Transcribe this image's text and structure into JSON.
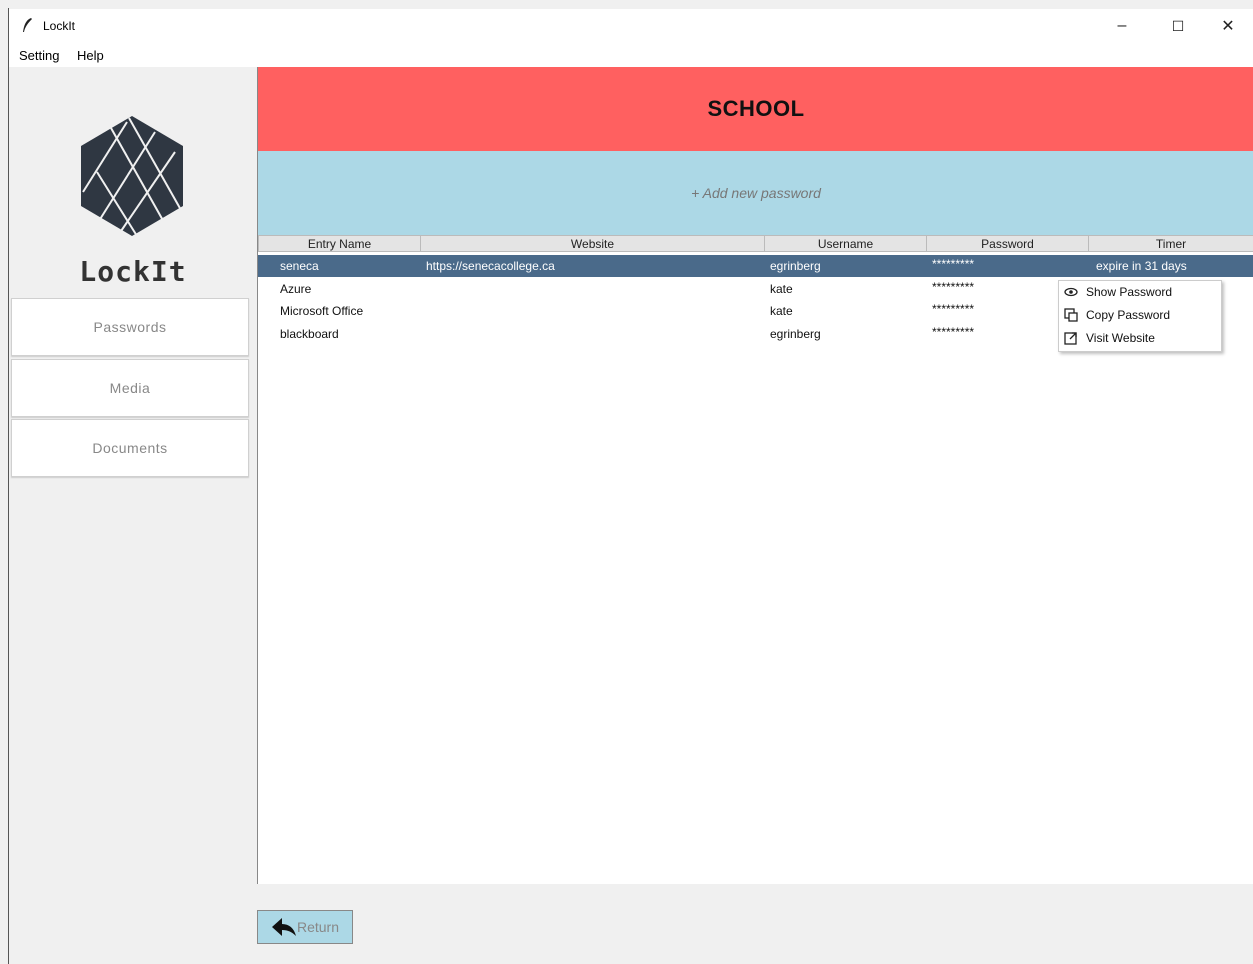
{
  "window": {
    "title": "LockIt",
    "minimize": "–",
    "maximize": "☐",
    "close": "✕"
  },
  "menu": {
    "items": [
      "Setting",
      "Help"
    ]
  },
  "sidebar": {
    "app_name": "LockIt",
    "nav": [
      "Passwords",
      "Media",
      "Documents"
    ]
  },
  "main": {
    "category_title": "SCHOOL",
    "add_label": "+ Add new password",
    "columns": [
      "Entry Name",
      "Website",
      "Username",
      "Password",
      "Timer"
    ],
    "rows": [
      {
        "entry": "seneca",
        "website": "https://senecacollege.ca",
        "username": "egrinberg",
        "password": "*********",
        "timer": "expire in 31 days",
        "selected": true
      },
      {
        "entry": "Azure",
        "website": "",
        "username": "kate",
        "password": "*********",
        "timer": ""
      },
      {
        "entry": "Microsoft Office",
        "website": "",
        "username": "kate",
        "password": "*********",
        "timer": ""
      },
      {
        "entry": "blackboard",
        "website": "",
        "username": "egrinberg",
        "password": "*********",
        "timer": ""
      }
    ]
  },
  "context_menu": {
    "items": [
      {
        "label": "Show Password",
        "icon": "eye-icon"
      },
      {
        "label": "Copy Password",
        "icon": "copy-icon"
      },
      {
        "label": "Visit Website",
        "icon": "external-link-icon"
      }
    ]
  },
  "footer": {
    "return_label": "Return",
    "return_icon": "return-arrow-icon"
  },
  "colors": {
    "banner": "#ff6060",
    "add_bar": "#acd8e6",
    "selected_row": "#4a6a8a",
    "logo": "#2f3742"
  }
}
